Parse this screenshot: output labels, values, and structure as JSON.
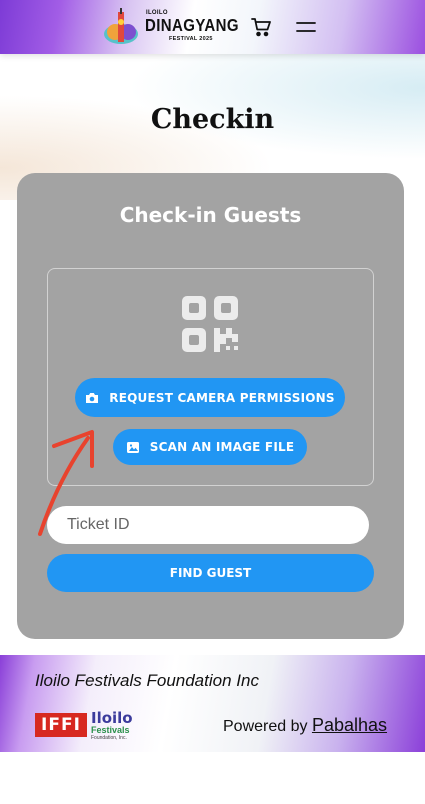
{
  "header": {
    "logo": {
      "small_text": "ILOILO",
      "main_text": "DINAGYANG",
      "sub_text": "FESTIVAL 2025"
    },
    "cart_icon": "cart-icon",
    "menu_icon": "hamburger-menu-icon"
  },
  "page": {
    "title": "Checkin"
  },
  "card": {
    "title": "Check-in Guests",
    "scanner": {
      "qr_icon": "qr-code-icon",
      "camera_button_label": "REQUEST CAMERA PERMISSIONS",
      "file_button_label": "SCAN AN IMAGE FILE"
    },
    "ticket_input": {
      "placeholder": "Ticket ID",
      "value": ""
    },
    "find_button_label": "FIND GUEST"
  },
  "footer": {
    "org_name": "Iloilo Festivals Foundation Inc",
    "logo": {
      "iffi_text": "IFFI",
      "iloilo_text": "Iloilo",
      "festivals_text": "Festivals",
      "foundation_text": "Foundation, Inc."
    },
    "powered_by_label": "Powered by",
    "powered_by_link": "Pabalhas"
  },
  "colors": {
    "primary_blue": "#2196f3",
    "card_gray": "#a3a3a3",
    "arrow_red": "#e8432e",
    "header_purple": "#8a3fd8"
  }
}
